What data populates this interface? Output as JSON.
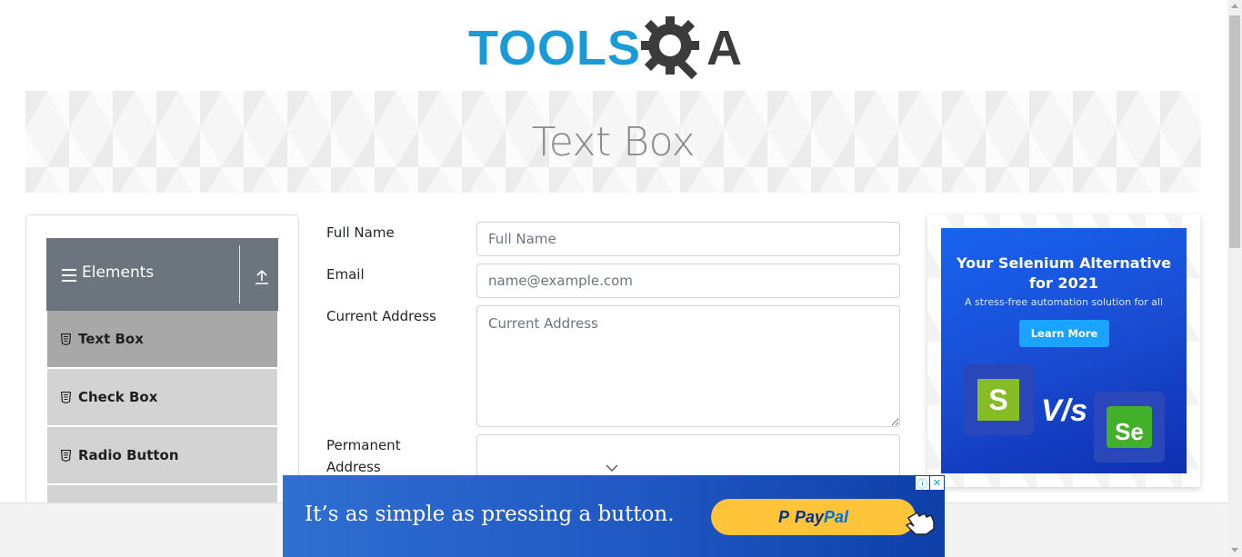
{
  "header": {
    "logo_part1": "TOOLS",
    "logo_part2": "A",
    "logo_icon": "gear-magnifier-icon"
  },
  "banner": {
    "title": "Text Box"
  },
  "sidebar": {
    "group_title": "Elements",
    "group_icons": [
      "hamburger-icon",
      "upload-arrow-icon"
    ],
    "items": [
      {
        "label": "Text Box",
        "active": true
      },
      {
        "label": "Check Box",
        "active": false
      },
      {
        "label": "Radio Button",
        "active": false
      }
    ]
  },
  "form": {
    "full_name": {
      "label": "Full Name",
      "placeholder": "Full Name",
      "value": ""
    },
    "email": {
      "label": "Email",
      "placeholder": "name@example.com",
      "value": ""
    },
    "current_address": {
      "label": "Current Address",
      "placeholder": "Current Address",
      "value": ""
    },
    "permanent_address": {
      "label_line1": "Permanent",
      "label_line2": "Address",
      "value": ""
    }
  },
  "right_ad": {
    "title_line1": "Your Selenium Alternative",
    "title_line2": "for 2021",
    "subtitle": "A stress-free automation solution for all",
    "button": "Learn More",
    "logo_left": "S",
    "vs": "V/s",
    "logo_right": "Se"
  },
  "bottom_ad": {
    "message": "It’s as simple as pressing a button.",
    "button_pay": "Pay",
    "button_pal": "Pal",
    "adchoice_info": "ⓘ",
    "adchoice_close": "✕"
  },
  "colors": {
    "brand_blue": "#1a9bd7",
    "brand_dark": "#3b3b3b",
    "menu_header": "#6c757d",
    "menu_item": "#d3d3d3",
    "menu_item_active": "#a8a8a8"
  }
}
